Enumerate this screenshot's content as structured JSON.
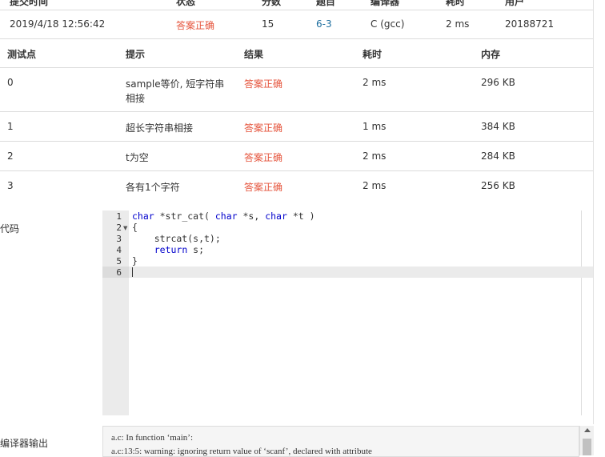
{
  "submission": {
    "header": [
      "提交时间",
      "状态",
      "分数",
      "题目",
      "编译器",
      "耗时",
      "用户"
    ],
    "time": "2019/4/18 12:56:42",
    "status": "答案正确",
    "score": "15",
    "problem": "6-3",
    "compiler": "C (gcc)",
    "runtime": "2 ms",
    "user": "20188721"
  },
  "testpoints": {
    "headers": [
      "测试点",
      "提示",
      "结果",
      "耗时",
      "内存"
    ],
    "rows": [
      {
        "id": "0",
        "hint_line1": "sample等价, 短字符串",
        "hint_line2": "相接",
        "result": "答案正确",
        "time": "2 ms",
        "memory": "296 KB"
      },
      {
        "id": "1",
        "hint_line1": "超长字符串相接",
        "hint_line2": "",
        "result": "答案正确",
        "time": "1 ms",
        "memory": "384 KB"
      },
      {
        "id": "2",
        "hint_line1": "t为空",
        "hint_line2": "",
        "result": "答案正确",
        "time": "2 ms",
        "memory": "284 KB"
      },
      {
        "id": "3",
        "hint_line1": "各有1个字符",
        "hint_line2": "",
        "result": "答案正确",
        "time": "2 ms",
        "memory": "256 KB"
      }
    ]
  },
  "code_section": {
    "label": "代码",
    "line_numbers": [
      "1",
      "2",
      "3",
      "4",
      "5",
      "6"
    ]
  },
  "compiler_section": {
    "label": "编译器输出",
    "lines": [
      "a.c: In function ‘main’:",
      "a.c:13:5: warning: ignoring return value of ‘scanf’, declared with attribute"
    ]
  },
  "colors": {
    "accepted": "#e5533b",
    "link": "#1f6f9f",
    "keyword": "#0000cc"
  }
}
